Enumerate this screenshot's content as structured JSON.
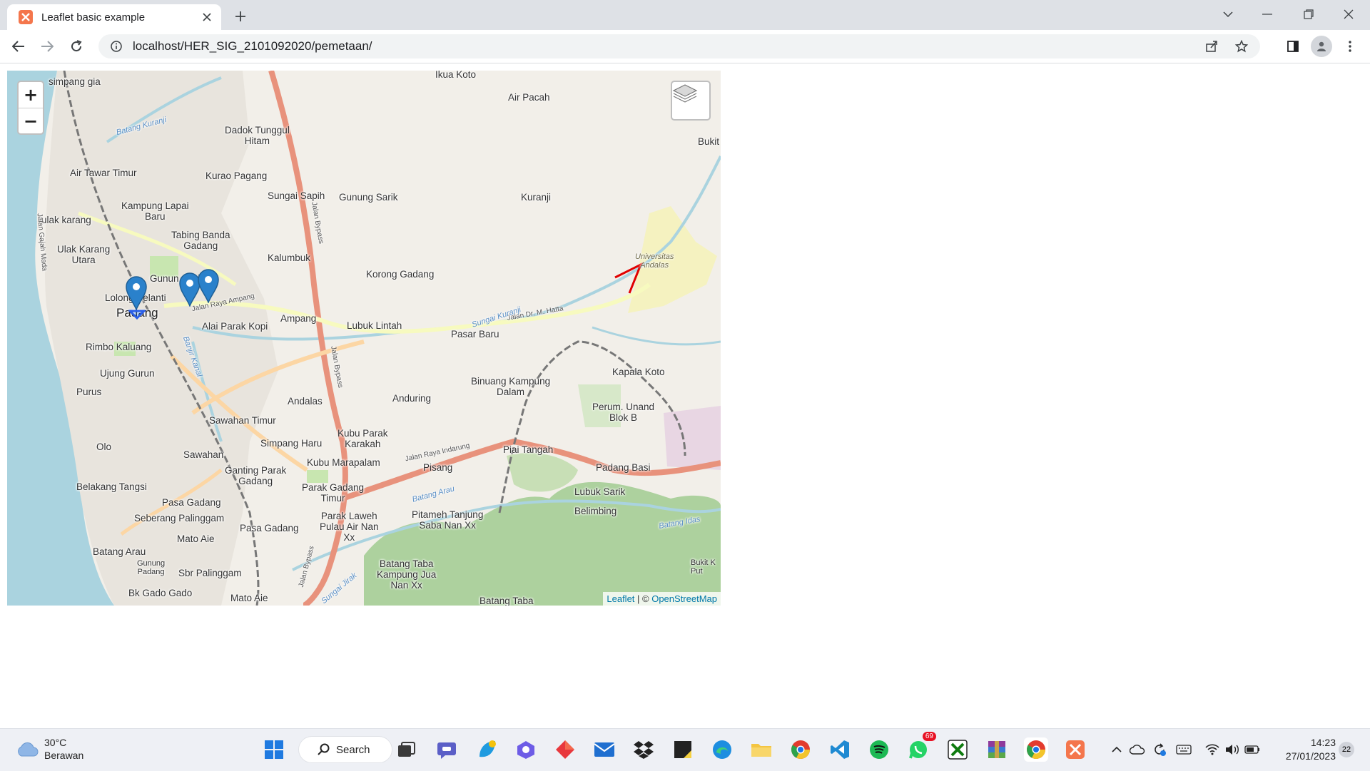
{
  "browser": {
    "tab_title": "Leaflet basic example",
    "url": "localhost/HER_SIG_2101092020/pemetaan/"
  },
  "map": {
    "zoom_in_label": "+",
    "zoom_out_label": "−",
    "attribution": {
      "leaflet": "Leaflet",
      "separator": " | © ",
      "osm": "OpenStreetMap"
    },
    "labels": {
      "simpang_gia": "simpang gia",
      "ikua_koto": "Ikua Koto",
      "air_pacah": "Air Pacah",
      "bukit": "Bukit",
      "dadok": "Dadok Tunggul\nHitam",
      "air_tawar": "Air Tawar Timur",
      "kurao": "Kurao Pagang",
      "sungai_sapih": "Sungai Sapih",
      "gunung_sarik": "Gunung Sarik",
      "kuranji": "Kuranji",
      "kampung_lapai": "Kampung Lapai\nBaru",
      "ulak_karang": "ulak karang",
      "tabing_banda": "Tabing Banda\nGadang",
      "ulak_karang_utara": "Ulak Karang\nUtara",
      "kalumbuk": "Kalumbuk",
      "korong_gadang": "Korong Gadang",
      "gunung_pangilun": "Gunun  angilun",
      "lolong": "Lolong Belanti",
      "padang": "Padang",
      "alai": "Alai Parak Kopi",
      "ampang": "Ampang",
      "lubuk_lintah": "Lubuk Lintah",
      "pasar_baru": "Pasar Baru",
      "rimbo": "Rimbo Kaluang",
      "ujung_gurun": "Ujung Gurun",
      "purus": "Purus",
      "binuang": "Binuang Kampung\nDalam",
      "kapala_koto": "Kapala Koto",
      "andalas": "Andalas",
      "anduring": "Anduring",
      "perum": "Perum. Unand\nBlok B",
      "sawahan_timur": "Sawahan Timur",
      "kubu_parak": "Kubu Parak\nKarakah",
      "simpang_haru": "Simpang Haru",
      "olo": "Olo",
      "sawahan": "Sawahan",
      "kubu_marapalam": "Kubu Marapalam",
      "piai_tangah": "Piai Tangah",
      "padang_basi": "Padang Basi",
      "ganting": "Ganting Parak\nGadang",
      "pisang": "Pisang",
      "belakang_tangsi": "Belakang Tangsi",
      "parak_gadang": "Parak Gadang\nTimur",
      "lubuk_sarik": "Lubuk Sarik",
      "pasa_gadang": "Pasa Gadang",
      "belimbing": "Belimbing",
      "seberang": "Seberang Palinggam",
      "parak_laweh": "Parak Laweh\nPulau Air Nan\nXx",
      "pitameh": "Pitameh Tanjung\nSaba Nan Xx",
      "pasa_gadang2": "Pasa Gadang",
      "mato_aie": "Mato Aie",
      "batang_arau": "Batang Arau",
      "gunung_padang": "Gunung\nPadang",
      "sbr": "Sbr Palinggam",
      "batang_taba": "Batang Taba\nKampung Jua\nNan Xx",
      "bk_gado": "Bk Gado Gado",
      "mato_aie2": "Mato Aie",
      "batang_taba2": "Batang Taba",
      "bukit_k": "Bukit K\nPut",
      "universitas": "Universitas\nAndalas",
      "jalan_raya_ampang": "Jalan Raya Ampang",
      "jalan_hatta": "Jalan Dr. M. Hatta",
      "jalan_indarung": "Jalan Raya Indarung",
      "jalan_bypass": "Jalan Bypass",
      "jalan_gajah_mada": "Jalan Gajah Mada",
      "sungai_kuranji": "Sungai Kuranji",
      "batang_kuranji": "Batang Kuranji",
      "batang_arau_river": "Batang Arau",
      "banjir_kanal": "Banjir Kanal",
      "batang_idas": "Batang Idas",
      "sungai_jirak": "Sungai Jirak"
    }
  },
  "taskbar": {
    "weather_temp": "30°C",
    "weather_desc": "Berawan",
    "search_label": "Search",
    "whatsapp_badge": "69",
    "time": "14:23",
    "date": "27/01/2023",
    "notifications": "22"
  }
}
